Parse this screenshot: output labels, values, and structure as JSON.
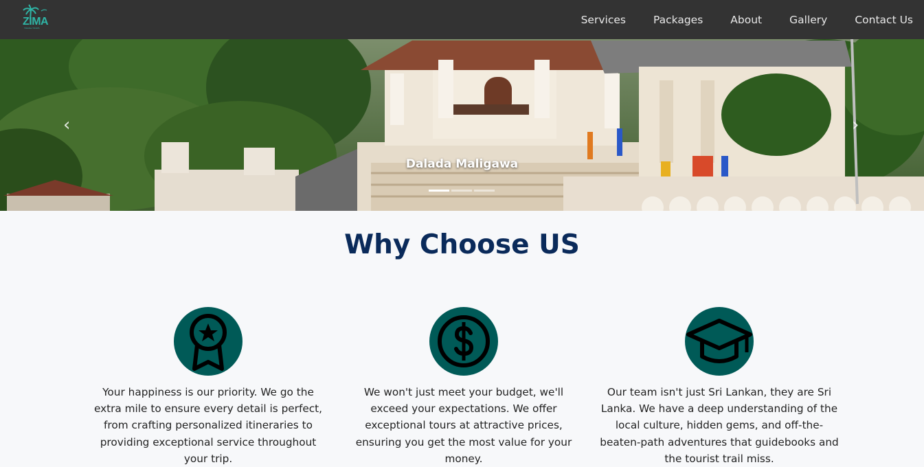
{
  "brand": {
    "logo_text": "ZIMA",
    "logo_sub": "TRAVEL TOURS"
  },
  "nav": {
    "items": [
      "Services",
      "Packages",
      "About",
      "Gallery",
      "Contact Us"
    ]
  },
  "hero": {
    "caption": "Dalada Maligawa",
    "prev_icon": "chevron-left-icon",
    "next_icon": "chevron-right-icon",
    "slide_count": 3,
    "active_slide": 1
  },
  "why": {
    "title": "Why Choose US",
    "features": [
      {
        "icon": "award-badge-icon",
        "text": "Your happiness is our priority. We go the extra mile to ensure every detail is perfect, from crafting personalized itineraries to providing exceptional service throughout your trip."
      },
      {
        "icon": "dollar-coin-icon",
        "text": "We won't just meet your budget, we'll exceed your expectations. We offer exceptional tours at attractive prices, ensuring you get the most value for your money."
      },
      {
        "icon": "graduation-cap-icon",
        "text": "Our team isn't just Sri Lankan, they are Sri Lanka. We have a deep understanding of the local culture, hidden gems, and off-the-beaten-path adventures that guidebooks and the tourist trail miss."
      }
    ]
  },
  "colors": {
    "navbar": "#333333",
    "accent": "#005a57",
    "title": "#0a2a5a",
    "logo": "#2fb5a6"
  }
}
